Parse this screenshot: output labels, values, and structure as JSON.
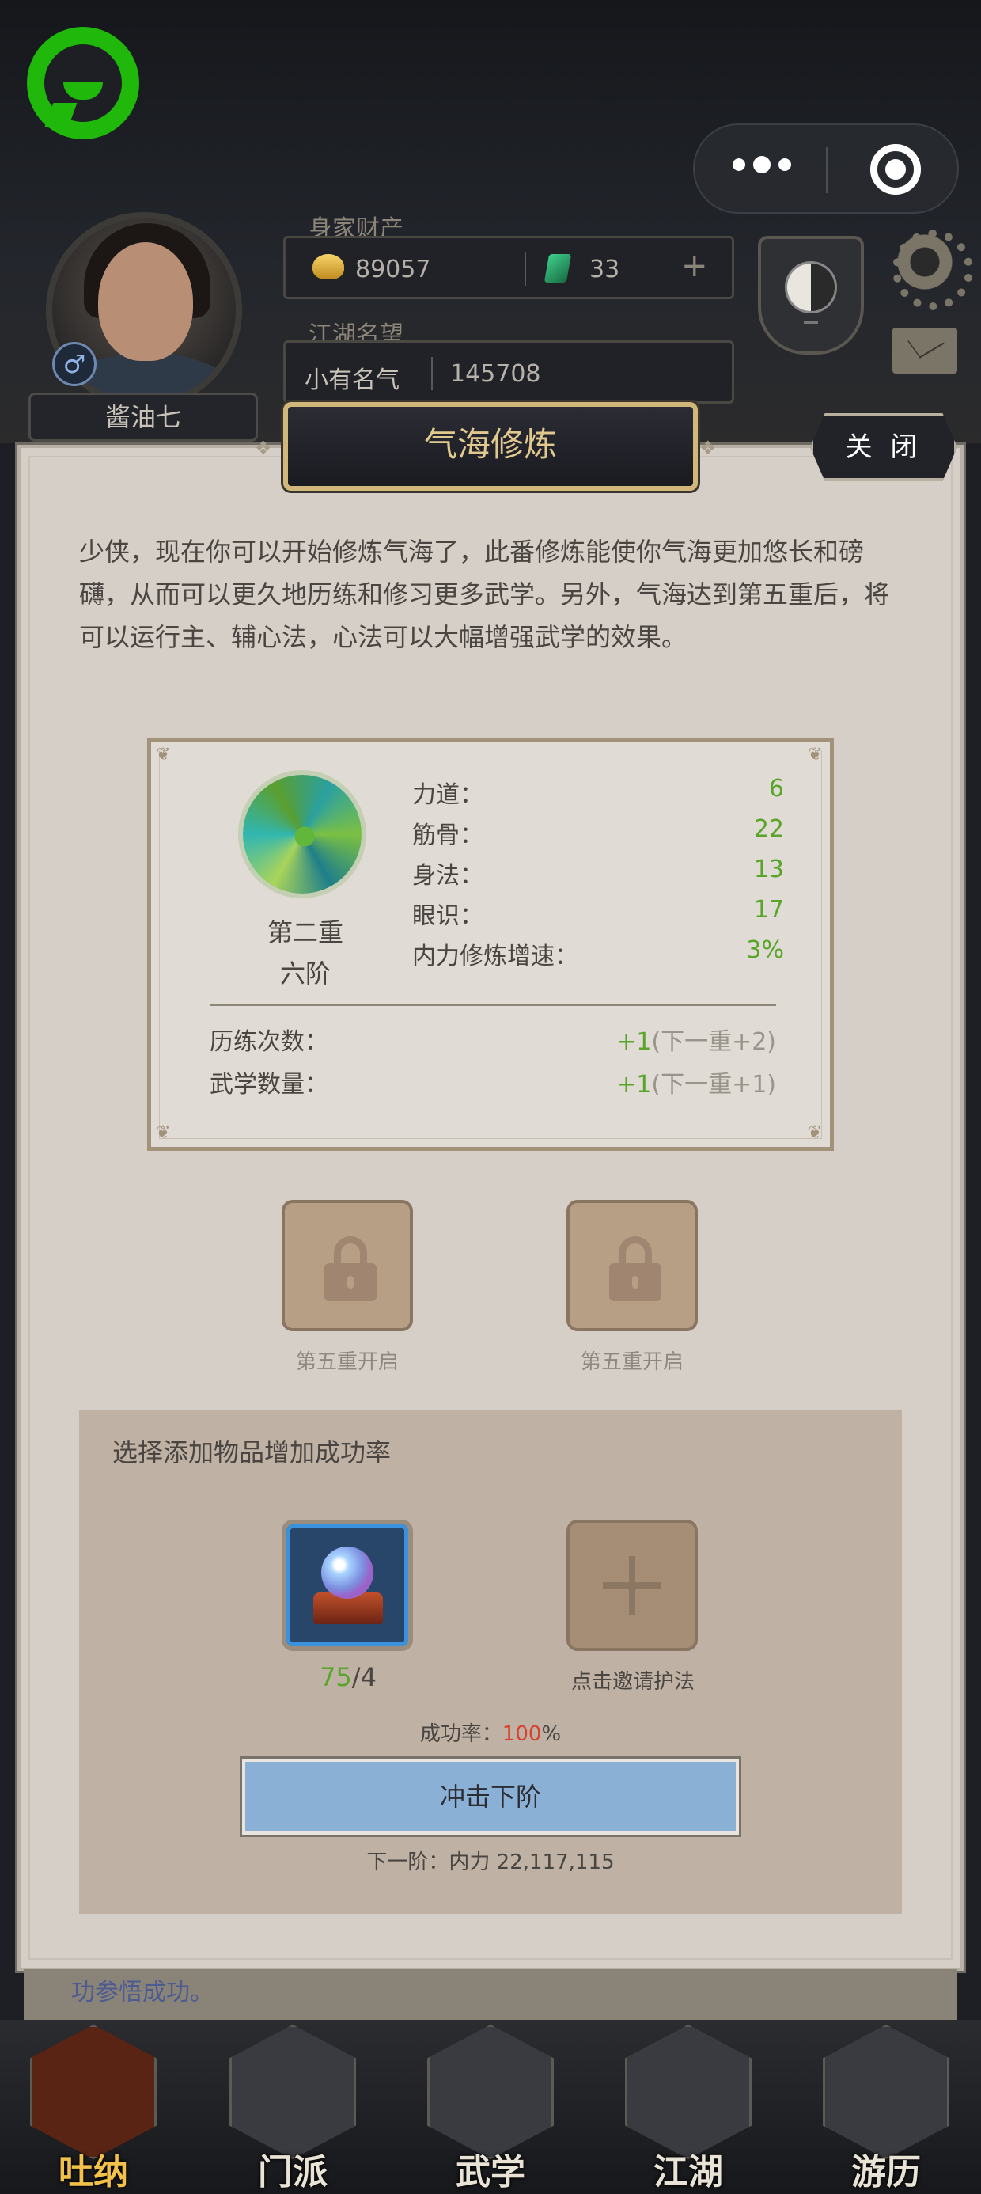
{
  "header": {
    "avatar_name": "酱油七",
    "gender_symbol": "♂",
    "wealth_label": "身家财产",
    "gold": "89057",
    "jade": "33",
    "add_symbol": "+",
    "fame_label": "江湖名望",
    "fame_title": "小有名气",
    "fame_value": "145708"
  },
  "modal": {
    "title": "气海修炼",
    "close_label": "关 闭",
    "intro": "少侠，现在你可以开始修炼气海了，此番修炼能使你气海更加悠长和磅礴，从而可以更久地历练和修习更多武学。另外，气海达到第五重后，将可以运行主、辅心法，心法可以大幅增强武学的效果。",
    "realm": {
      "layer": "第二重",
      "stage": "六阶"
    },
    "stats": [
      {
        "label": "力道：",
        "value": "6"
      },
      {
        "label": "筋骨：",
        "value": "22"
      },
      {
        "label": "身法：",
        "value": "13"
      },
      {
        "label": "眼识：",
        "value": "17"
      },
      {
        "label": "内力修炼增速：",
        "value": "3%"
      }
    ],
    "bonuses": [
      {
        "label": "历练次数：",
        "value": "+1",
        "next": "(下一重+2)"
      },
      {
        "label": "武学数量：",
        "value": "+1",
        "next": "(下一重+1)"
      }
    ],
    "locked_slots": [
      {
        "caption": "第五重开启"
      },
      {
        "caption": "第五重开启"
      }
    ],
    "boost": {
      "title": "选择添加物品增加成功率",
      "item_have": "75",
      "item_need": "/4",
      "invite_caption": "点击邀请护法",
      "success_label": "成功率：",
      "success_pct": "100",
      "success_unit": "%",
      "button_label": "冲击下阶",
      "next_label": "下一阶：内力 22,117,115"
    }
  },
  "log_text": "功参悟成功。",
  "nav": [
    {
      "label": "吐纳",
      "active": true
    },
    {
      "label": "门派",
      "active": false
    },
    {
      "label": "武学",
      "active": false
    },
    {
      "label": "江湖",
      "active": false
    },
    {
      "label": "游历",
      "active": false
    }
  ],
  "colors": {
    "stat_green": "#58a52a",
    "success_red": "#d8412e",
    "button_blue": "#8bb0d6",
    "title_gold": "#e1c88f",
    "wechat_green": "#1fb80b"
  },
  "icons": [
    "wechat-icon",
    "more-icon",
    "target-icon",
    "gold-icon",
    "jade-icon",
    "taiji-icon",
    "gear-icon",
    "mail-icon",
    "lock-icon",
    "crystal-ball-icon",
    "plus-icon"
  ]
}
